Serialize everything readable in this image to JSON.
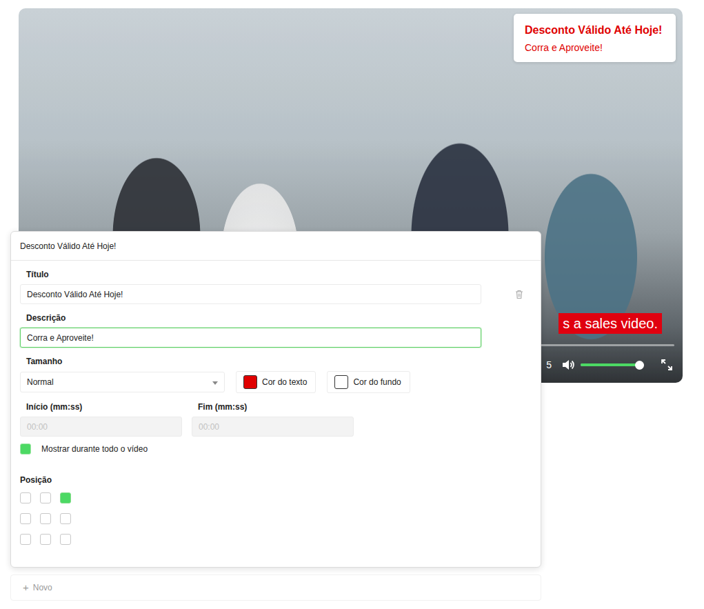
{
  "video": {
    "overlay": {
      "title": "Desconto Válido Até Hoje!",
      "description": "Corra e Aproveite!"
    },
    "caption": "s a sales video.",
    "time": "5",
    "volume": {
      "level": 0.92
    }
  },
  "editor": {
    "header": "Desconto Válido Até Hoje!",
    "title": {
      "label": "Título",
      "value": "Desconto Válido Até Hoje!"
    },
    "description": {
      "label": "Descrição",
      "value": "Corra e Aproveite!",
      "focused": true
    },
    "size": {
      "label": "Tamanho",
      "value": "Normal"
    },
    "colors": [
      {
        "label": "Cor do texto",
        "color": "#e00000"
      },
      {
        "label": "Cor do fundo",
        "color": "#ffffff"
      }
    ],
    "start": {
      "label": "Início (mm:ss)",
      "placeholder": "00:00",
      "disabled": true
    },
    "end": {
      "label": "Fim (mm:ss)",
      "placeholder": "00:00",
      "disabled": true
    },
    "whole_video": {
      "label": "Mostrar durante todo o vídeo",
      "checked": true
    },
    "position": {
      "label": "Posição",
      "cells": [
        {
          "selected": false
        },
        {
          "selected": false
        },
        {
          "selected": true
        },
        {
          "selected": false
        },
        {
          "selected": false
        },
        {
          "selected": false
        },
        {
          "selected": false
        },
        {
          "selected": false
        },
        {
          "selected": false
        }
      ]
    }
  },
  "new_button": {
    "icon": "+",
    "label": "Novo"
  }
}
